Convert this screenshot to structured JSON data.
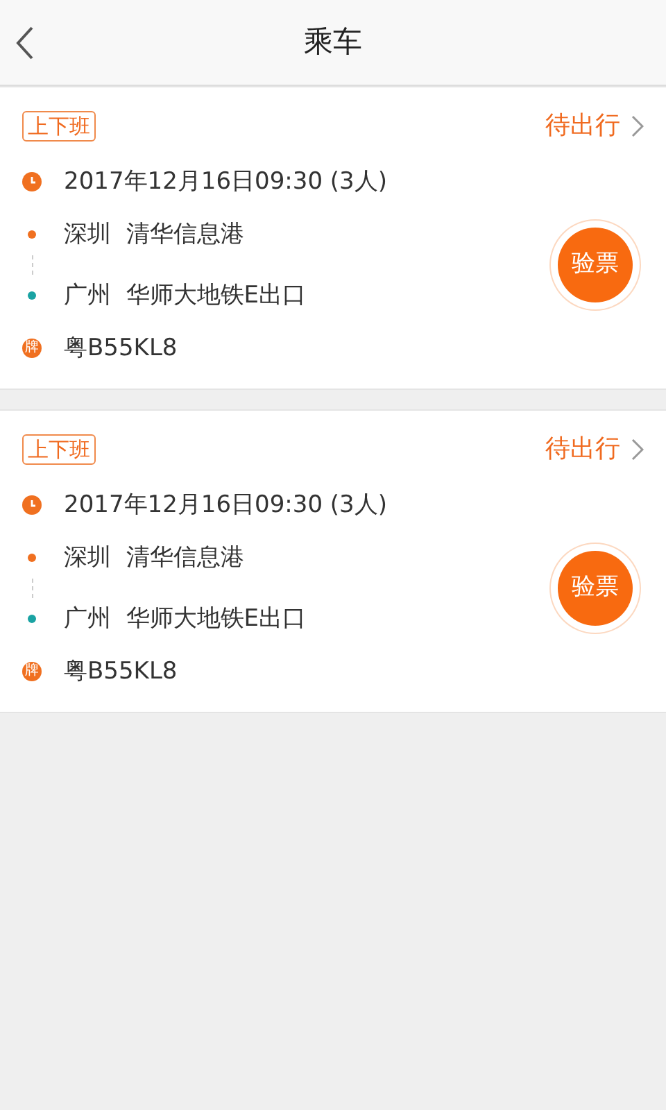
{
  "header": {
    "title": "乘车"
  },
  "trips": [
    {
      "tag": "上下班",
      "status": "待出行",
      "datetime": "2017年12月16日09:30 (3人)",
      "from": "深圳  清华信息港",
      "to": "广州  华师大地铁E出口",
      "plate_icon": "牌",
      "plate": "粤B55KL8",
      "action": "验票"
    },
    {
      "tag": "上下班",
      "status": "待出行",
      "datetime": "2017年12月16日09:30 (3人)",
      "from": "深圳  清华信息港",
      "to": "广州  华师大地铁E出口",
      "plate_icon": "牌",
      "plate": "粤B55KL8",
      "action": "验票"
    }
  ]
}
